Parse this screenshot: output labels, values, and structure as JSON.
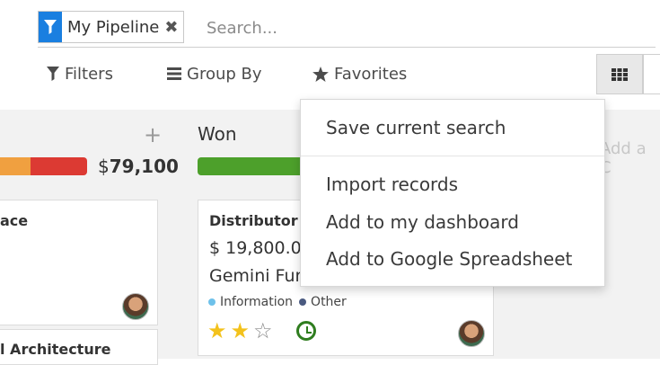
{
  "search": {
    "facet_label": "My Pipeline",
    "placeholder": "Search..."
  },
  "toolbar": {
    "filters_label": "Filters",
    "group_by_label": "Group By",
    "favorites_label": "Favorites"
  },
  "kanban": {
    "column1": {
      "amount_prefix": "$",
      "amount": "79,100"
    },
    "column2": {
      "title": "Won"
    },
    "add_column_label": "Add a C",
    "cards": {
      "card1_title": "ace",
      "card2_title": "l Architecture",
      "card3": {
        "title": "Distributor C",
        "amount": "$ 19,800.00",
        "customer": "Gemini Fur",
        "tags": [
          {
            "label": "Information",
            "color": "#6ec1ea"
          },
          {
            "label": "Other",
            "color": "#4a5a80"
          }
        ],
        "stars_filled": 2,
        "stars_total": 3
      }
    }
  },
  "favorites_menu": {
    "save_current_search": "Save current search",
    "import_records": "Import records",
    "add_to_dashboard": "Add to my dashboard",
    "add_to_spreadsheet": "Add to Google Spreadsheet"
  },
  "colors": {
    "facet_accent": "#1a7fe0",
    "won_bar": "#4da02b",
    "bar_orange": "#f0a040",
    "bar_red": "#dc3a33",
    "star": "#f3c21c",
    "activity_clock": "#2f7d1f"
  }
}
